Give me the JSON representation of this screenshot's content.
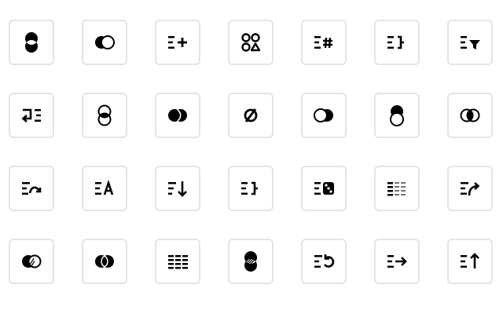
{
  "icon_color": "#000000",
  "tile_border_color": "#e4e4e4",
  "rows": [
    [
      "intersect-vertical-icon",
      "difference-horizontal-icon",
      "list-plus-icon",
      "shapes-icon",
      "list-hash-icon",
      "list-bracket-icon",
      "list-filter-icon"
    ],
    [
      "list-return-icon",
      "intersect-vertical-outline-icon",
      "union-horizontal-icon",
      "empty-set-icon",
      "exclude-horizontal-icon",
      "subtract-top-icon",
      "intersect-horizontal-icon"
    ],
    [
      "list-redo-icon",
      "list-text-icon",
      "list-sort-down-icon",
      "list-bracket-alt-icon",
      "list-dice-icon",
      "list-dotted-icon",
      "list-share-icon"
    ],
    [
      "subtract-hatched-icon",
      "overlap-horizontal-icon",
      "list-columns-icon",
      "intersect-hatched-icon",
      "list-undo-icon",
      "list-arrow-right-icon",
      "list-sort-up-icon"
    ]
  ]
}
